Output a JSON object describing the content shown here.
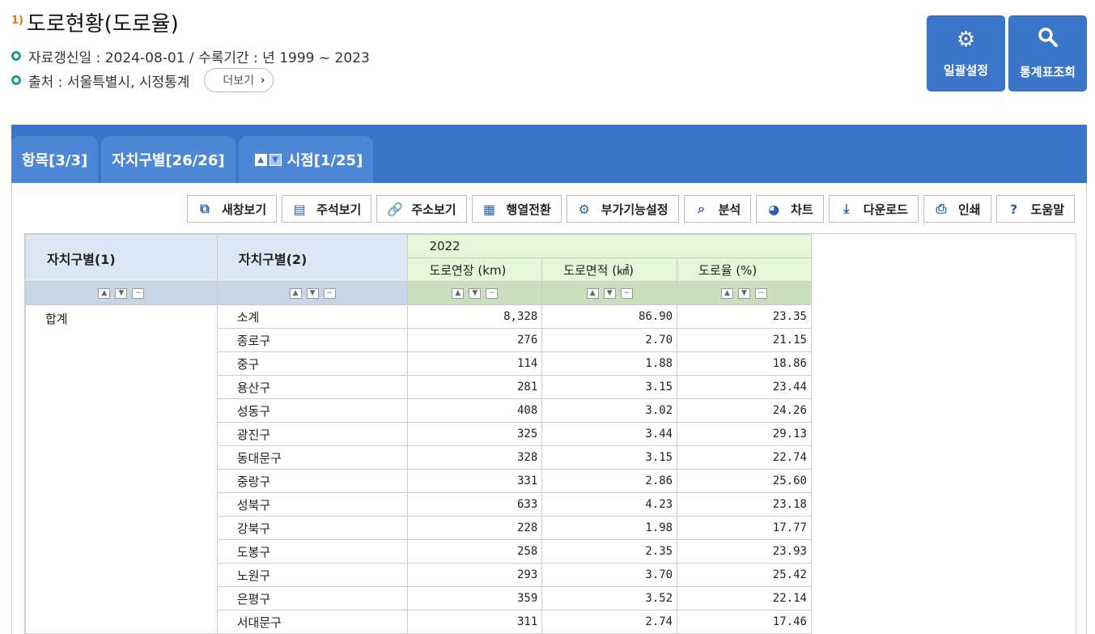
{
  "header": {
    "title_num": "1)",
    "title": "도로현황(도로율)",
    "update_info": "자료갱신일 : 2024-08-01 / 수록기간 : 년 1999 ~ 2023",
    "source": "출처 : 서울특별시, 시정통계",
    "more_label": "더보기",
    "more_chevron": "›"
  },
  "top_actions": {
    "bulk_settings": "일괄설정",
    "stats_query": "통계표조회",
    "bulk_settings_icon": "gear-icon",
    "stats_query_icon": "search-icon"
  },
  "tabs": [
    {
      "label": "항목[3/3]"
    },
    {
      "label": "자치구별[26/26]"
    },
    {
      "label": "시점[1/25]"
    }
  ],
  "toolbar": [
    {
      "label": "새창보기",
      "icon": "window-icon",
      "glyph": "⧉"
    },
    {
      "label": "주석보기",
      "icon": "comment-icon",
      "glyph": "▤"
    },
    {
      "label": "주소보기",
      "icon": "link-icon",
      "glyph": "🔗"
    },
    {
      "label": "행열전환",
      "icon": "pivot-icon",
      "glyph": "▦"
    },
    {
      "label": "부가기능설정",
      "icon": "gear-icon",
      "glyph": "⚙"
    },
    {
      "label": "분석",
      "icon": "analysis-icon",
      "glyph": "⌕"
    },
    {
      "label": "차트",
      "icon": "pie-chart-icon",
      "glyph": "◕"
    },
    {
      "label": "다운로드",
      "icon": "download-icon",
      "glyph": "⤓"
    },
    {
      "label": "인쇄",
      "icon": "print-icon",
      "glyph": "⎙"
    },
    {
      "label": "도움말",
      "icon": "help-icon",
      "glyph": "?"
    }
  ],
  "table": {
    "col1_header": "자치구별(1)",
    "col2_header": "자치구별(2)",
    "year": "2022",
    "measure_headers": [
      "도로연장 (km)",
      "도로면적 (㎢)",
      "도로율 (%)"
    ],
    "group_label": "합계",
    "rows": [
      {
        "district": "소계",
        "length": "8,328",
        "area": "86.90",
        "rate": "23.35"
      },
      {
        "district": "종로구",
        "length": "276",
        "area": "2.70",
        "rate": "21.15"
      },
      {
        "district": "중구",
        "length": "114",
        "area": "1.88",
        "rate": "18.86"
      },
      {
        "district": "용산구",
        "length": "281",
        "area": "3.15",
        "rate": "23.44"
      },
      {
        "district": "성동구",
        "length": "408",
        "area": "3.02",
        "rate": "24.26"
      },
      {
        "district": "광진구",
        "length": "325",
        "area": "3.44",
        "rate": "29.13"
      },
      {
        "district": "동대문구",
        "length": "328",
        "area": "3.15",
        "rate": "22.74"
      },
      {
        "district": "중랑구",
        "length": "331",
        "area": "2.86",
        "rate": "25.60"
      },
      {
        "district": "성북구",
        "length": "633",
        "area": "4.23",
        "rate": "23.18"
      },
      {
        "district": "강북구",
        "length": "228",
        "area": "1.98",
        "rate": "17.77"
      },
      {
        "district": "도봉구",
        "length": "258",
        "area": "2.35",
        "rate": "23.93"
      },
      {
        "district": "노원구",
        "length": "293",
        "area": "3.70",
        "rate": "25.42"
      },
      {
        "district": "은평구",
        "length": "359",
        "area": "3.52",
        "rate": "22.14"
      },
      {
        "district": "서대문구",
        "length": "311",
        "area": "2.74",
        "rate": "17.46"
      }
    ]
  },
  "colors": {
    "brand_blue": "#3b75c9",
    "tab_blue": "#4d88d6",
    "accent_teal": "#1a9d8f",
    "header_blue": "#dce8f5",
    "header_green": "#e4f7d9"
  }
}
